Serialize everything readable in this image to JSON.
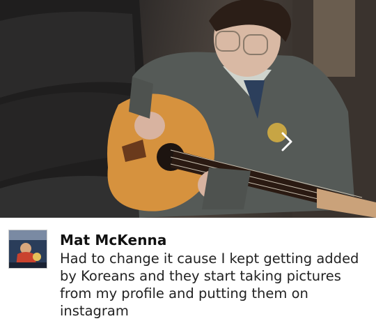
{
  "media": {
    "scene": "photo-young-man-with-glasses-playing-acoustic-guitar",
    "next_icon": "chevron-right-icon"
  },
  "comment": {
    "avatar_icon": "user-thumbnail",
    "author": "Mat McKenna",
    "text": "Had to change it cause I kept getting added by Koreans and they start taking pictures from my profile and putting them on instagram"
  }
}
